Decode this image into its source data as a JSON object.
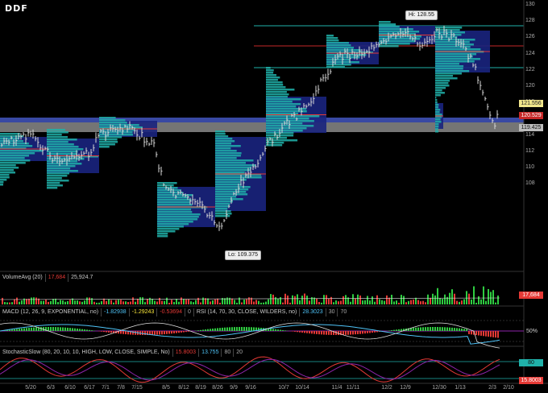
{
  "logo": "DDF",
  "price_axis": {
    "ticks": [
      "130",
      "128",
      "126",
      "124",
      "122",
      "120",
      "118",
      "116",
      "114",
      "112",
      "110",
      "108"
    ],
    "tag_current_high": "121.556",
    "tag_current_red": "120.529",
    "tag_current": "119.425",
    "colors": {
      "tag_high": "#f0e68c",
      "tag_red": "#c62828",
      "tag_current": "#bdbdbd"
    }
  },
  "callouts": {
    "hi": "Hi: 128.55",
    "lo": "Lo: 109.375"
  },
  "date_axis": [
    "5/20",
    "6/3",
    "6/10",
    "6/17",
    "7/1",
    "7/8",
    "7/15",
    "8/5",
    "8/12",
    "8/19",
    "8/26",
    "9/9",
    "9/16",
    "10/7",
    "10/14",
    "11/4",
    "11/11",
    "12/2",
    "12/9",
    "12/30",
    "1/13",
    "2/3",
    "2/10"
  ],
  "volume": {
    "header": [
      "VolumeAvg (20)",
      "17,684",
      "25,924.7"
    ],
    "tag": "17,684"
  },
  "macd": {
    "header": [
      "MACD (12, 26, 9, EXPONENTIAL, no)",
      "-1.82938",
      "-1.29243",
      "-0.53694",
      "0"
    ],
    "rsi_header": [
      "RSI (14, 70, 30, CLOSE, WILDERS, no)",
      "28.3023",
      "30",
      "70"
    ],
    "tag": "50%"
  },
  "stochastic": {
    "header": [
      "StochasticSlow (80, 20, 10, 10, HIGH, LOW, CLOSE, SIMPLE, No)",
      "15.8003",
      "13.755",
      "80",
      "20"
    ],
    "tag_80": "80",
    "tag_value": "15.8003"
  },
  "colors": {
    "up": "#2ecc40",
    "down": "#e53935",
    "bar_up": "#d8d8d8",
    "profile": "#20b2aa",
    "value_area": "#1a237e"
  }
}
